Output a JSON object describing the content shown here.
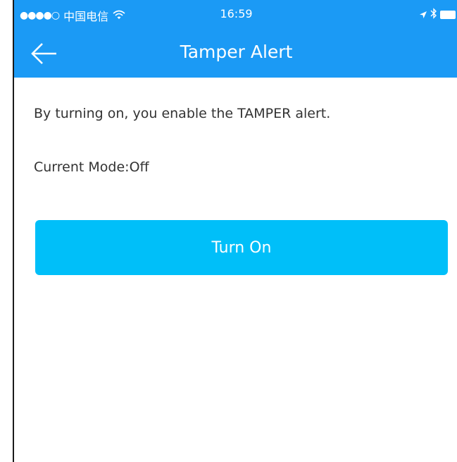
{
  "status_bar": {
    "signal": "●●●●○",
    "carrier": "中国电信",
    "wifi_icon": "wifi-icon",
    "time": "16:59",
    "location_icon": "location-arrow-icon",
    "bluetooth_icon": "bluetooth-icon",
    "battery_icon": "battery-icon"
  },
  "nav": {
    "back_icon": "back-arrow-icon",
    "title": "Tamper Alert"
  },
  "content": {
    "description": "By turning on, you enable the TAMPER alert.",
    "current_mode": "Current Mode:Off",
    "button_label": "Turn On"
  },
  "colors": {
    "header_bg": "#1b9af5",
    "button_bg": "#00bff9",
    "text": "#333333"
  }
}
